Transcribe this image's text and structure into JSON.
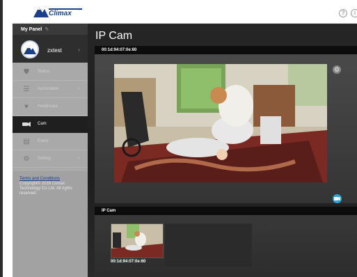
{
  "header": {
    "brand": "Climax",
    "help_icon": "?"
  },
  "sidebar": {
    "panel_title": "My Panel",
    "user": {
      "name": "zxtest"
    },
    "items": [
      {
        "label": "Status",
        "icon": "shield-icon"
      },
      {
        "label": "Automation",
        "icon": "sliders-icon"
      },
      {
        "label": "Healthcare",
        "icon": "heart-icon"
      },
      {
        "label": "Cam",
        "icon": "camera-icon",
        "active": true
      },
      {
        "label": "Event",
        "icon": "list-icon"
      },
      {
        "label": "Setting",
        "icon": "gear-icon"
      }
    ],
    "terms_label": "Terms and Conditions",
    "copyright": "Copyright© 2018 Climax Technology Co Ltd. All rights reserved."
  },
  "main": {
    "title": "IP Cam",
    "live_panel": {
      "camera_id": "00:1d:94:07:0e:60"
    },
    "list_panel": {
      "heading": "IP Cam",
      "cameras": [
        {
          "camera_id": "00:1d:94:07:0e:60"
        }
      ]
    }
  },
  "colors": {
    "accent": "#2aa3d9",
    "brand": "#1c3f8c",
    "sidebar_bg": "#a9a9a9",
    "active_bg": "#1f1f1f"
  }
}
